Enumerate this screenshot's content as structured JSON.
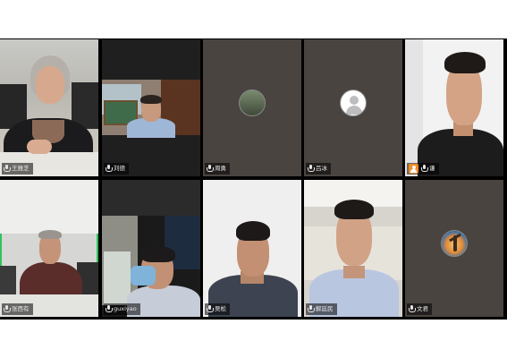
{
  "meeting": {
    "participants": [
      {
        "name": "王雅芝",
        "muted": false,
        "video": true
      },
      {
        "name": "刘德",
        "muted": false,
        "video": true
      },
      {
        "name": "周勇",
        "muted": false,
        "video": false,
        "avatar": "photo"
      },
      {
        "name": "吕冰",
        "muted": false,
        "video": false,
        "avatar": "default-user-icon"
      },
      {
        "name": "谦",
        "muted": false,
        "video": true,
        "host": true
      },
      {
        "name": "张西有",
        "muted": false,
        "video": true,
        "active_speaker": true
      },
      {
        "name": "guxiyao",
        "muted": false,
        "video": true
      },
      {
        "name": "吴松",
        "muted": false,
        "video": true
      },
      {
        "name": "解廷民",
        "muted": false,
        "video": true
      },
      {
        "name": "文君",
        "muted": false,
        "video": false,
        "avatar": "moon-figure"
      }
    ]
  },
  "colors": {
    "stage_bg": "#000000",
    "tile_empty_bg": "#4a4440",
    "active_speaker_border": "#2fc25b",
    "host_badge": "#f08a24"
  }
}
